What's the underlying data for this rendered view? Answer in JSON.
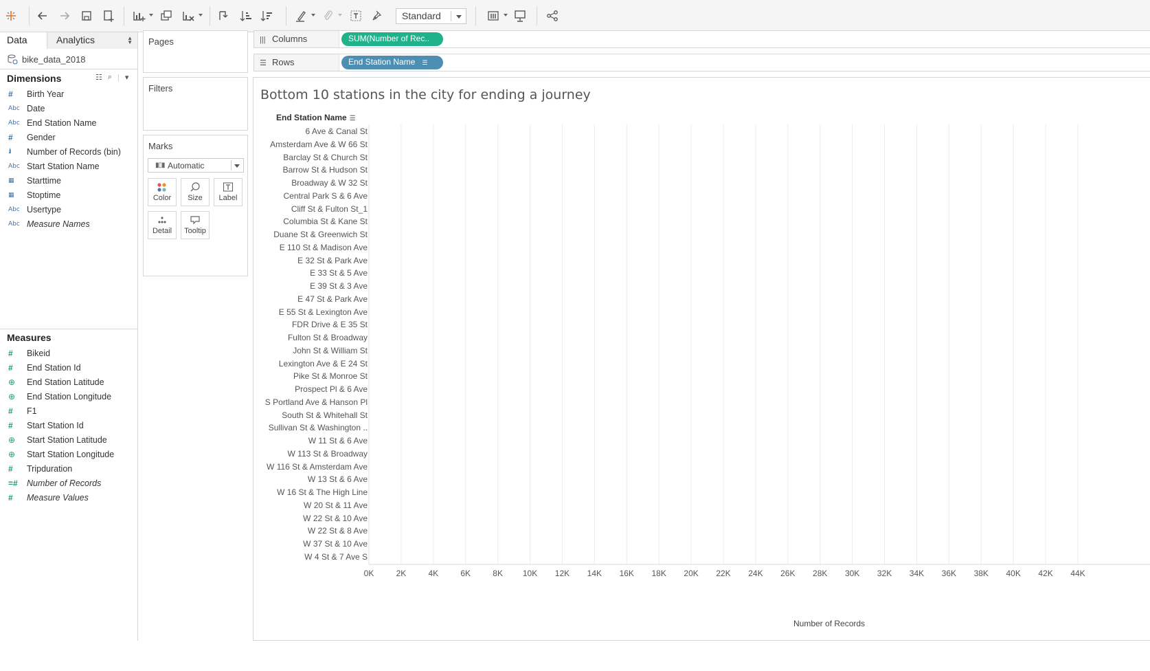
{
  "toolbar": {
    "fit_mode": "Standard"
  },
  "data_pane": {
    "tabs": [
      "Data",
      "Analytics"
    ],
    "datasource": "bike_data_2018",
    "dimensions_title": "Dimensions",
    "measures_title": "Measures",
    "dimensions": [
      {
        "label": "Birth Year",
        "icon": "hash",
        "italic": false
      },
      {
        "label": "Date",
        "icon": "abc",
        "italic": false
      },
      {
        "label": "End Station Name",
        "icon": "abc",
        "italic": false
      },
      {
        "label": "Gender",
        "icon": "hash",
        "italic": false
      },
      {
        "label": "Number of Records (bin)",
        "icon": "bars",
        "italic": false
      },
      {
        "label": "Start Station Name",
        "icon": "abc",
        "italic": false
      },
      {
        "label": "Starttime",
        "icon": "calendar",
        "italic": false
      },
      {
        "label": "Stoptime",
        "icon": "calendar",
        "italic": false
      },
      {
        "label": "Usertype",
        "icon": "abc",
        "italic": false
      },
      {
        "label": "Measure Names",
        "icon": "abc",
        "italic": true
      }
    ],
    "measures": [
      {
        "label": "Bikeid",
        "icon": "hash",
        "italic": false
      },
      {
        "label": "End Station Id",
        "icon": "hash",
        "italic": false
      },
      {
        "label": "End Station Latitude",
        "icon": "globe",
        "italic": false
      },
      {
        "label": "End Station Longitude",
        "icon": "globe",
        "italic": false
      },
      {
        "label": "F1",
        "icon": "hash",
        "italic": false
      },
      {
        "label": "Start Station Id",
        "icon": "hash",
        "italic": false
      },
      {
        "label": "Start Station Latitude",
        "icon": "globe",
        "italic": false
      },
      {
        "label": "Start Station Longitude",
        "icon": "globe",
        "italic": false
      },
      {
        "label": "Tripduration",
        "icon": "hash",
        "italic": false
      },
      {
        "label": "Number of Records",
        "icon": "hash-calc",
        "italic": true
      },
      {
        "label": "Measure Values",
        "icon": "hash",
        "italic": true
      }
    ]
  },
  "cards": {
    "pages": "Pages",
    "filters": "Filters",
    "marks": "Marks",
    "marks_type": "Automatic",
    "mark_buttons": [
      "Color",
      "Size",
      "Label",
      "Detail",
      "Tooltip"
    ]
  },
  "shelves": {
    "columns_label": "Columns",
    "rows_label": "Rows",
    "columns_pill": "SUM(Number of Rec..",
    "rows_pill": "End Station Name"
  },
  "viz": {
    "title": "Bottom 10 stations in the city for ending a journey",
    "row_header": "End Station Name"
  },
  "chart_data": {
    "type": "bar",
    "title": "Bottom 10 stations in the city for ending a journey",
    "xlabel": "Number of Records",
    "ylabel": "End Station Name",
    "xlim": [
      0,
      44000
    ],
    "x_tick_labels": [
      "0K",
      "2K",
      "4K",
      "6K",
      "8K",
      "10K",
      "12K",
      "14K",
      "16K",
      "18K",
      "20K",
      "22K",
      "24K",
      "26K",
      "28K",
      "30K",
      "32K",
      "34K",
      "36K",
      "38K",
      "40K",
      "42K",
      "44K"
    ],
    "grid": true,
    "categories": [
      "6 Ave & Canal St",
      "Amsterdam Ave & W 66 St",
      "Barclay St & Church St",
      "Barrow St & Hudson St",
      "Broadway & W 32 St",
      "Central Park S & 6 Ave",
      "Cliff St & Fulton St_1",
      "Columbia St & Kane St",
      "Duane St & Greenwich St",
      "E 110 St & Madison Ave",
      "E 32 St & Park Ave",
      "E 33 St & 5 Ave",
      "E 39 St & 3 Ave",
      "E 47 St & Park Ave",
      "E 55 St & Lexington Ave",
      "FDR Drive & E 35 St",
      "Fulton St & Broadway",
      "John St & William St",
      "Lexington Ave & E 24 St",
      "Pike St & Monroe St",
      "Prospect Pl & 6 Ave",
      "S Portland Ave & Hanson Pl",
      "South St & Whitehall St",
      "Sullivan St & Washington ..",
      "W 11 St & 6 Ave",
      "W 113 St & Broadway",
      "W 116 St & Amsterdam Ave",
      "W 13 St & 6 Ave",
      "W 16 St & The High Line",
      "W 20 St & 11 Ave",
      "W 22 St & 10 Ave",
      "W 22 St & 8 Ave",
      "W 37 St & 10 Ave",
      "W 4 St & 7 Ave S"
    ],
    "values": []
  }
}
